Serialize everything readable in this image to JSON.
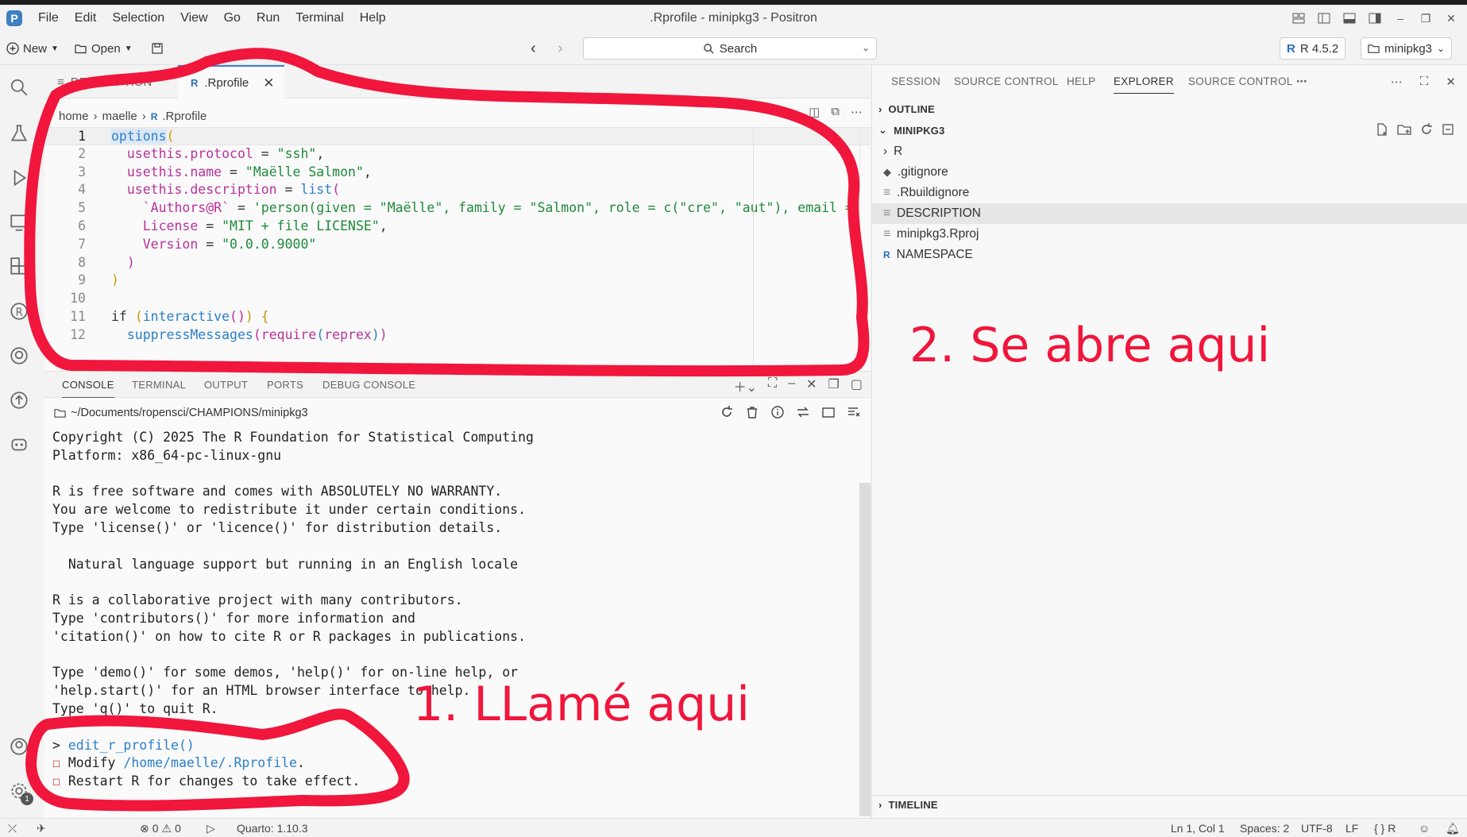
{
  "window": {
    "title": ".Rprofile - minipkg3 - Positron",
    "logo": "P"
  },
  "menu": [
    "File",
    "Edit",
    "Selection",
    "View",
    "Go",
    "Run",
    "Terminal",
    "Help"
  ],
  "toolbar": {
    "new_label": "New",
    "open_label": "Open",
    "search_label": "Search",
    "r_version": "R 4.5.2",
    "project": "minipkg3"
  },
  "editor": {
    "tabs": [
      {
        "label": "DESCRIPTION",
        "active": false
      },
      {
        "label": ".Rprofile",
        "active": true
      }
    ],
    "breadcrumb": [
      "home",
      "maelle",
      ".Rprofile"
    ],
    "line_numbers": [
      "1",
      "2",
      "3",
      "4",
      "5",
      "6",
      "7",
      "8",
      "9",
      "10",
      "11",
      "12"
    ],
    "code_lines": [
      "options(",
      "  usethis.protocol = \"ssh\",",
      "  usethis.name = \"Maëlle Salmon\",",
      "  usethis.description = list(",
      "    `Authors@R` = 'person(given = \"Maëlle\", family = \"Salmon\", role = c(\"cre\", \"aut\"), email =",
      "    License = \"MIT + file LICENSE\",",
      "    Version = \"0.0.0.9000\"",
      "  )",
      ")",
      "",
      "if (interactive()) {",
      "  suppressMessages(require(reprex))"
    ]
  },
  "panel": {
    "tabs": [
      "CONSOLE",
      "TERMINAL",
      "OUTPUT",
      "PORTS",
      "DEBUG CONSOLE"
    ],
    "path": "~/Documents/ropensci/CHAMPIONS/minipkg3",
    "console_lines": [
      "Copyright (C) 2025 The R Foundation for Statistical Computing",
      "Platform: x86_64-pc-linux-gnu",
      "",
      "R is free software and comes with ABSOLUTELY NO WARRANTY.",
      "You are welcome to redistribute it under certain conditions.",
      "Type 'license()' or 'licence()' for distribution details.",
      "",
      "  Natural language support but running in an English locale",
      "",
      "R is a collaborative project with many contributors.",
      "Type 'contributors()' for more information and",
      "'citation()' on how to cite R or R packages in publications.",
      "",
      "Type 'demo()' for some demos, 'help()' for on-line help, or",
      "'help.start()' for an HTML browser interface to help.",
      "Type 'q()' to quit R.",
      ""
    ],
    "prompt": ">",
    "command": "edit_r_profile()",
    "bullet": "☐",
    "modify_text": "Modify",
    "modify_path": "/home/maelle/.Rprofile",
    "modify_end": ".",
    "restart_text": "Restart R for changes to take effect."
  },
  "sidebar": {
    "tabs": [
      "SESSION",
      "SOURCE CONTROL",
      "HELP",
      "EXPLORER",
      "SOURCE CONTROL"
    ],
    "outline_label": "OUTLINE",
    "folder_label": "MINIPKG3",
    "timeline_label": "TIMELINE",
    "files": [
      {
        "name": "R",
        "kind": "folder"
      },
      {
        "name": ".gitignore",
        "kind": "git"
      },
      {
        "name": ".Rbuildignore",
        "kind": "file"
      },
      {
        "name": "DESCRIPTION",
        "kind": "file",
        "selected": true
      },
      {
        "name": "minipkg3.Rproj",
        "kind": "file"
      },
      {
        "name": "NAMESPACE",
        "kind": "r"
      }
    ]
  },
  "statusbar": {
    "errors": "0",
    "warnings": "0",
    "quarto": "Quarto: 1.10.3",
    "position": "Ln 1, Col 1",
    "spaces": "Spaces: 2",
    "encoding": "UTF-8",
    "eol": "LF",
    "language": "R",
    "notifications": "1"
  },
  "annotations": {
    "label_editor": "2. Se abre aqui",
    "label_console": "1. LLamé aqui",
    "color": "#f0163c"
  }
}
